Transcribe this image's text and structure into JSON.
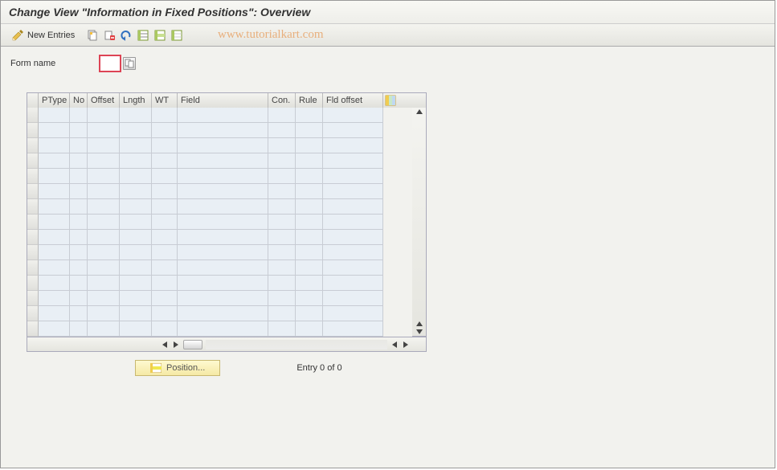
{
  "title": "Change View \"Information in Fixed Positions\": Overview",
  "toolbar": {
    "new_entries_label": "New Entries"
  },
  "watermark": "www.tutorialkart.com",
  "form": {
    "name_label": "Form name",
    "name_value": ""
  },
  "table": {
    "columns": {
      "ptype": "PType",
      "no": "No",
      "offset": "Offset",
      "lngth": "Lngth",
      "wt": "WT",
      "field": "Field",
      "con": "Con.",
      "rule": "Rule",
      "fld_offset": "Fld offset"
    }
  },
  "footer": {
    "position_label": "Position...",
    "entry_text": "Entry 0 of 0"
  }
}
